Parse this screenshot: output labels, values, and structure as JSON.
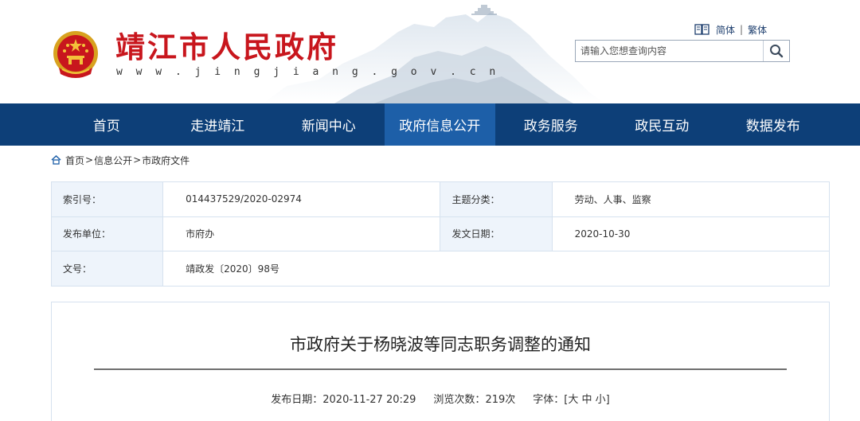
{
  "header": {
    "site_title": "靖江市人民政府",
    "site_url": "w w w . j i n g j i a n g . g o v . c n",
    "lang": {
      "simplified": "简体",
      "separator": "|",
      "traditional": "繁体"
    },
    "search": {
      "placeholder": "请输入您想查询内容",
      "icon": "search-icon"
    },
    "colors": {
      "title_red": "#c8161d",
      "nav_bg": "#0d3f78",
      "nav_active": "#1d5fa8",
      "table_key_bg": "#eef4fb"
    }
  },
  "nav": {
    "items": [
      {
        "label": "首页"
      },
      {
        "label": "走进靖江"
      },
      {
        "label": "新闻中心"
      },
      {
        "label": "政府信息公开",
        "active": true
      },
      {
        "label": "政务服务"
      },
      {
        "label": "政民互动"
      },
      {
        "label": "数据发布"
      }
    ]
  },
  "breadcrumb": {
    "icon": "home-icon",
    "items": [
      "首页",
      "信息公开",
      "市政府文件"
    ],
    "separator": ">"
  },
  "info": {
    "index_label": "索引号：",
    "index_value": "014437529/2020-02974",
    "topic_label": "主题分类：",
    "topic_value": "劳动、人事、监察",
    "publisher_label": "发布单位：",
    "publisher_value": "市府办",
    "issue_date_label": "发文日期：",
    "issue_date_value": "2020-10-30",
    "doc_no_label": "文号：",
    "doc_no_value": "靖政发〔2020〕98号"
  },
  "article": {
    "title": "市政府关于杨晓波等同志职务调整的通知",
    "publish_label": "发布日期：",
    "publish_value": "2020-11-27 20:29",
    "views_label": "浏览次数：",
    "views_value": "219次",
    "font_label": "字体：[",
    "font_large": "大",
    "font_medium": "中",
    "font_small": "小",
    "font_close": "]"
  }
}
